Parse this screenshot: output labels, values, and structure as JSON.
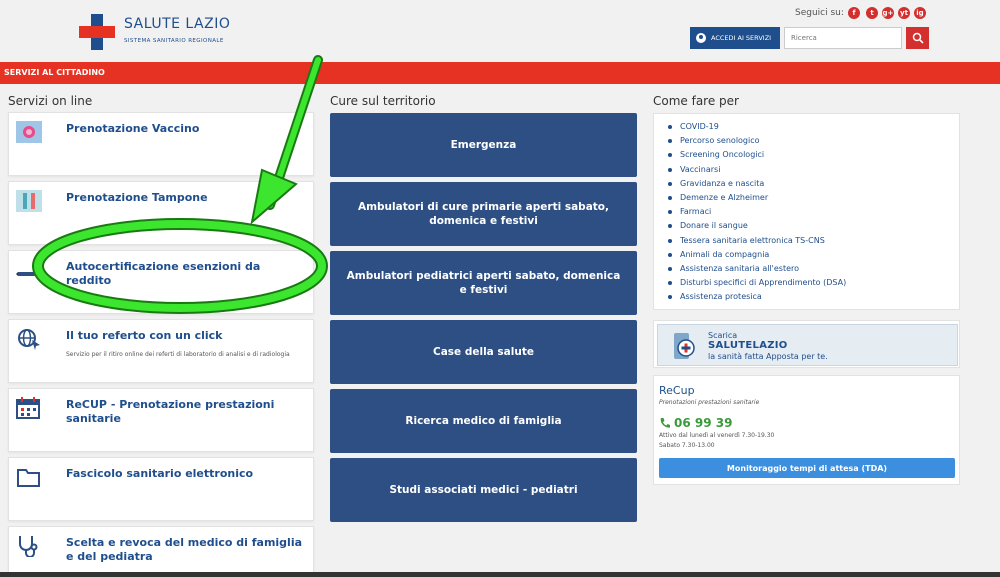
{
  "header": {
    "brand_title": "SALUTE LAZIO",
    "brand_subtitle": "SISTEMA SANITARIO REGIONALE",
    "follow_label": "Seguici su:",
    "social": [
      "f",
      "t",
      "g+",
      "yt",
      "ig"
    ],
    "access_label": "ACCEDI AI SERVIZI",
    "search_placeholder": "Ricerca"
  },
  "nav": {
    "label": "SERVIZI AL CITTADINO"
  },
  "sections": {
    "online": "Servizi on line",
    "territory": "Cure sul territorio",
    "howto": "Come fare per"
  },
  "online_services": [
    {
      "label": "Prenotazione Vaccino",
      "desc": ""
    },
    {
      "label": "Prenotazione Tampone",
      "desc": ""
    },
    {
      "label": "Autocertificazione esenzioni da reddito",
      "desc": ""
    },
    {
      "label": "Il tuo referto con un click",
      "desc": "Servizio per il ritiro online dei referti di laboratorio di analisi e di radiologia"
    },
    {
      "label": "ReCUP - Prenotazione prestazioni sanitarie",
      "desc": ""
    },
    {
      "label": "Fascicolo sanitario elettronico",
      "desc": ""
    },
    {
      "label": "Scelta e revoca del medico di famiglia e del pediatra",
      "desc": ""
    }
  ],
  "territory_tiles": [
    "Emergenza",
    "Ambulatori di cure primarie aperti sabato, domenica e festivi",
    "Ambulatori pediatrici aperti sabato, domenica e festivi",
    "Case della salute",
    "Ricerca medico di famiglia",
    "Studi associati medici - pediatri"
  ],
  "howto_links": [
    "COVID-19",
    "Percorso senologico",
    "Screening Oncologici",
    "Vaccinarsi",
    "Gravidanza e nascita",
    "Demenze e Alzheimer",
    "Farmaci",
    "Donare il sangue",
    "Tessera sanitaria elettronica TS-CNS",
    "Animali da compagnia",
    "Assistenza sanitaria all'estero",
    "Disturbi specifici di Apprendimento (DSA)",
    "Assistenza protesica"
  ],
  "app_banner": {
    "line1": "Scarica",
    "line2": "SALUTELAZIO",
    "line3": "la sanità fatta Apposta per te."
  },
  "recup": {
    "title": "ReCup",
    "subtitle": "Prenotazioni prestazioni sanitarie",
    "phone": "06 99 39",
    "hours1": "Attivo dal lunedì al venerdì 7.30-19.30",
    "hours2": "Sabato 7.30-13.00",
    "button": "Monitoraggio tempi di attesa (TDA)"
  },
  "colors": {
    "brand_blue": "#1f4e8c",
    "tile_blue": "#2d4f84",
    "nav_red": "#e53222",
    "annotation_green": "#38e22c"
  }
}
